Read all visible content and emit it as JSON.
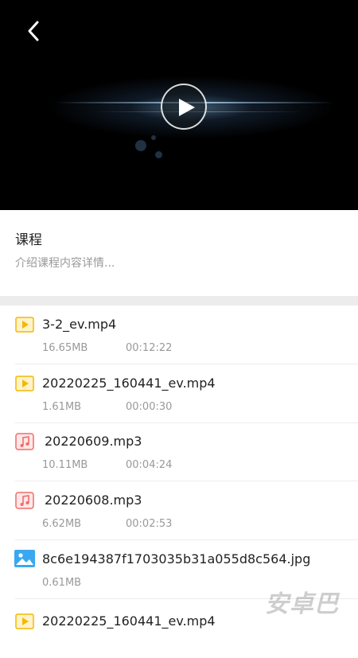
{
  "course": {
    "title": "课程",
    "description": "介绍课程内容详情..."
  },
  "files": [
    {
      "type": "video",
      "icon": "video-file-icon",
      "name": "3-2_ev.mp4",
      "size": "16.65MB",
      "duration": "00:12:22"
    },
    {
      "type": "video",
      "icon": "video-file-icon",
      "name": "20220225_160441_ev.mp4",
      "size": "1.61MB",
      "duration": "00:00:30"
    },
    {
      "type": "audio",
      "icon": "music-file-icon",
      "name": "20220609.mp3",
      "size": "10.11MB",
      "duration": "00:04:24"
    },
    {
      "type": "audio",
      "icon": "music-file-icon",
      "name": "20220608.mp3",
      "size": "6.62MB",
      "duration": "00:02:53"
    },
    {
      "type": "image",
      "icon": "image-file-icon",
      "name": "8c6e194387f1703035b31a055d8c564.jpg",
      "size": "0.61MB",
      "duration": ""
    },
    {
      "type": "video",
      "icon": "video-file-icon",
      "name": "20220225_160441_ev.mp4",
      "size": "",
      "duration": ""
    }
  ],
  "watermark": "安卓巴",
  "colors": {
    "video_icon": "#f5b800",
    "audio_icon": "#f26b6b",
    "image_icon": "#3aa8f0"
  }
}
